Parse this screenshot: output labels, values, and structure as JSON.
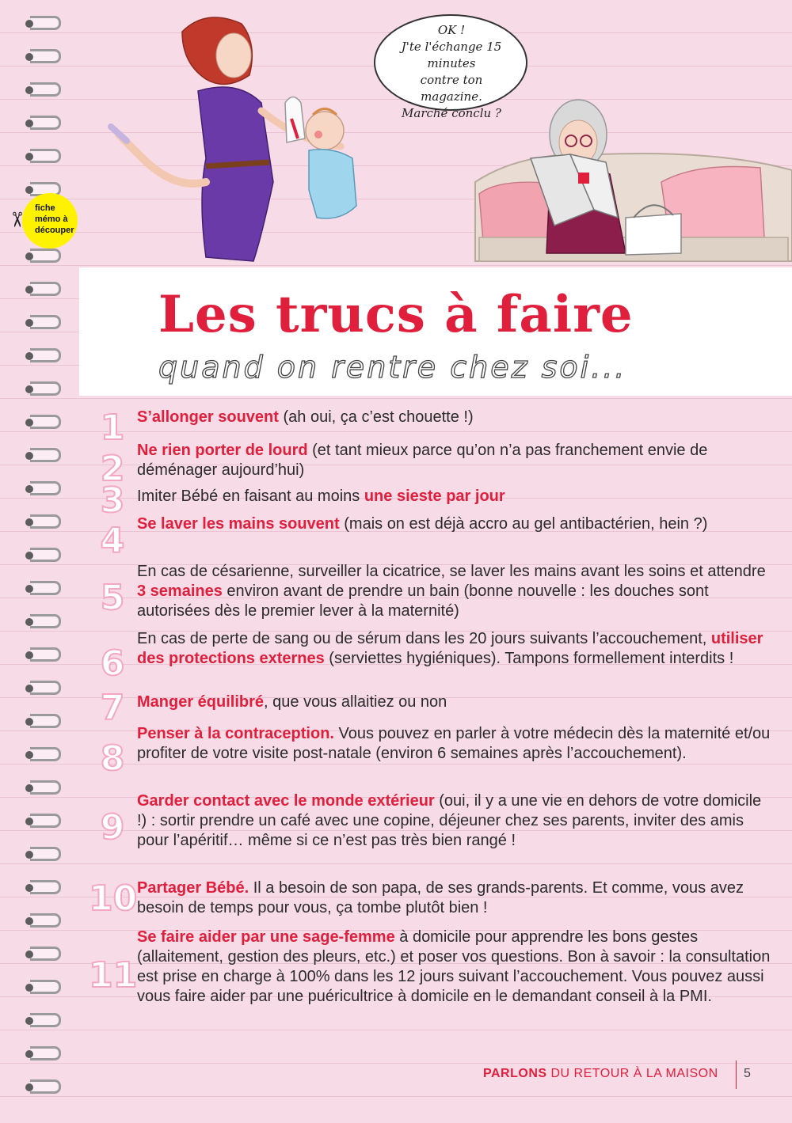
{
  "badge": {
    "line1": "fiche",
    "line2": "mémo à",
    "line3": "découper",
    "icon": "scissors-icon"
  },
  "speech_bubble": {
    "line1": "OK !",
    "line2": "J'te l'échange 15 minutes",
    "line3": "contre ton magazine.",
    "line4": "Marché conclu ?"
  },
  "title": {
    "main": "Les trucs à faire",
    "sub": "quand on rentre chez soi..."
  },
  "items": [
    {
      "num": "1",
      "parts": [
        {
          "hl": "S’allonger souvent"
        },
        {
          "t": " (ah oui, ça c’est chouette !)"
        }
      ]
    },
    {
      "num": "2",
      "parts": [
        {
          "hl": "Ne rien porter de lourd"
        },
        {
          "t": " (et tant mieux parce qu’on n’a pas franchement envie de déménager aujourd’hui)"
        }
      ]
    },
    {
      "num": "3",
      "parts": [
        {
          "t": "Imiter Bébé en faisant au moins "
        },
        {
          "hl": "une sieste par jour"
        }
      ]
    },
    {
      "num": "4",
      "parts": [
        {
          "hl": "Se laver les mains souvent"
        },
        {
          "t": " (mais on est déjà accro au gel antibactérien, hein ?)"
        }
      ]
    },
    {
      "num": "5",
      "parts": [
        {
          "t": "En cas de césarienne, surveiller la cicatrice, se laver les mains avant les soins et attendre "
        },
        {
          "hl": "3 semaines"
        },
        {
          "t": " environ avant de prendre un bain (bonne nouvelle : les douches sont autorisées dès le premier lever à la maternité)"
        }
      ]
    },
    {
      "num": "6",
      "parts": [
        {
          "t": "En cas de perte de sang ou de sérum dans les 20 jours suivants l’accouchement, "
        },
        {
          "hl": "utiliser des protections externes"
        },
        {
          "t": " (serviettes hygiéniques). Tampons formellement interdits !"
        }
      ]
    },
    {
      "num": "7",
      "parts": [
        {
          "hl": "Manger équilibré"
        },
        {
          "t": ", que vous allaitiez ou non"
        }
      ]
    },
    {
      "num": "8",
      "parts": [
        {
          "hl": "Penser à la contraception."
        },
        {
          "t": " Vous pouvez en parler à votre médecin dès la maternité et/ou profiter de votre visite post-natale (environ 6 semaines après l’accouchement)."
        }
      ]
    },
    {
      "num": "9",
      "parts": [
        {
          "hl": "Garder contact avec le monde extérieur"
        },
        {
          "t": " (oui, il y a une vie en dehors de votre domicile !) : sortir prendre un café avec une copine, déjeuner chez ses parents, inviter des amis pour l’apéritif… même si ce n’est pas très bien rangé !"
        }
      ]
    },
    {
      "num": "10",
      "parts": [
        {
          "hl": "Partager Bébé."
        },
        {
          "t": " Il a besoin de son papa, de ses grands-parents. Et comme, vous avez besoin de temps pour vous, ça tombe plutôt bien !"
        }
      ]
    },
    {
      "num": "11",
      "parts": [
        {
          "hl": "Se faire aider par une sage-femme"
        },
        {
          "t": " à domicile pour apprendre les bons gestes (allaitement, gestion des pleurs, etc.) et poser vos questions. Bon à savoir : la consultation est prise en charge à 100% dans les 12 jours suivant l’accouchement. Vous pouvez aussi vous faire aider par une puéricultrice à domicile en le demandant conseil à la PMI."
        }
      ]
    }
  ],
  "footer": {
    "bold": "PARLONS",
    "rest": " DU RETOUR À LA MAISON",
    "page": "5"
  },
  "colors": {
    "accent": "#e01f3d",
    "number_outline": "#f3a7c3",
    "background": "#f7dbe6",
    "badge": "#fff200"
  }
}
